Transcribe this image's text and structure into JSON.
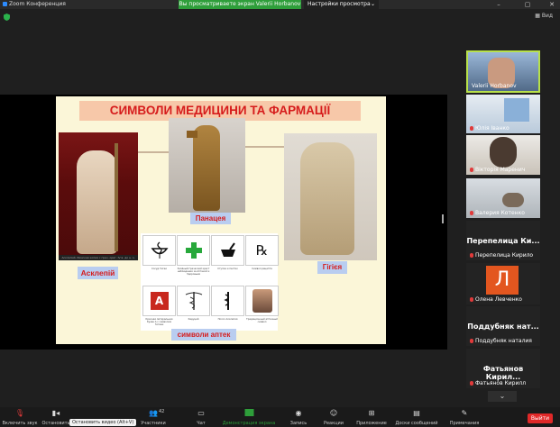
{
  "titlebar": {
    "app_title": "Zoom Конференция",
    "share_banner": "Вы просматриваете экран Valerii Horbanov",
    "view_settings": "Настройки просмотра",
    "view_button": "Вид"
  },
  "slide": {
    "title": "СИМВОЛИ МЕДИЦИНИ ТА ФАРМАЦІЇ",
    "label_asklepiy": "Асклепій",
    "label_panacea": "Панацея",
    "label_hygeia": "Гігієя",
    "label_pharmacy": "символи аптек",
    "asklepiy_caption": "Асклепий. Римская копия с греч. ориг. IV в. до н. э.",
    "grid_items": [
      {
        "icon": "bowl-snake",
        "caption": "Сосуд Гигеи"
      },
      {
        "icon": "green-cross",
        "caption": "Зелёный Греческий крест наблюдения за Аптекой и Здоровьем"
      },
      {
        "icon": "mortar-pestle",
        "caption": "Ступка и пестик"
      },
      {
        "icon": "rx",
        "caption": "Символ рецепта"
      },
      {
        "icon": "red-a-sign",
        "caption": "Красная литеральная буква А с символом Гигиеи"
      },
      {
        "icon": "caduceus",
        "caption": "Кадуцей"
      },
      {
        "icon": "rod-of-asclepius",
        "caption": "Посох Асклепия"
      },
      {
        "icon": "portrait",
        "caption": "Традиционный аптечный символ"
      }
    ]
  },
  "participants": [
    {
      "name": "Valerii Horbanov",
      "type": "video",
      "active": true
    },
    {
      "name": "Юлія Іванко",
      "type": "video",
      "muted": true
    },
    {
      "name": "Вікторія Маренич",
      "type": "video",
      "muted": true
    },
    {
      "name": "Валерия Котенко",
      "type": "video",
      "muted": true
    },
    {
      "name": "Перепелица Кирило",
      "type": "name",
      "big": "Перепелица Ки...",
      "muted": true
    },
    {
      "name": "Олена Левченко",
      "type": "avatar",
      "initial": "Л",
      "muted": true
    },
    {
      "name": "Поддубняк наталия",
      "type": "name",
      "big": "Поддубняк нат...",
      "muted": true
    },
    {
      "name": "Фатьянов Кирилл",
      "type": "name",
      "big": "Фатьянов Кирил...",
      "muted": true
    }
  ],
  "toolbar": {
    "mute": "Включить звук",
    "stop_video": "Остановить",
    "tooltip": "Остановить видео (Alt+V)",
    "participants": "Участники",
    "participants_count": "42",
    "chat": "Чат",
    "share_screen": "Демонстрация экрана",
    "record": "Запись",
    "reactions": "Реакции",
    "apps": "Приложение",
    "whiteboards": "Доски сообщений",
    "notes": "Примечания",
    "end": "Выйти"
  },
  "colors": {
    "accent_green": "#2e9e3a",
    "title_red": "#d61c1c",
    "title_bg": "#f7c8a9",
    "label_bg": "#b9cdf0",
    "end_red": "#e02828"
  }
}
